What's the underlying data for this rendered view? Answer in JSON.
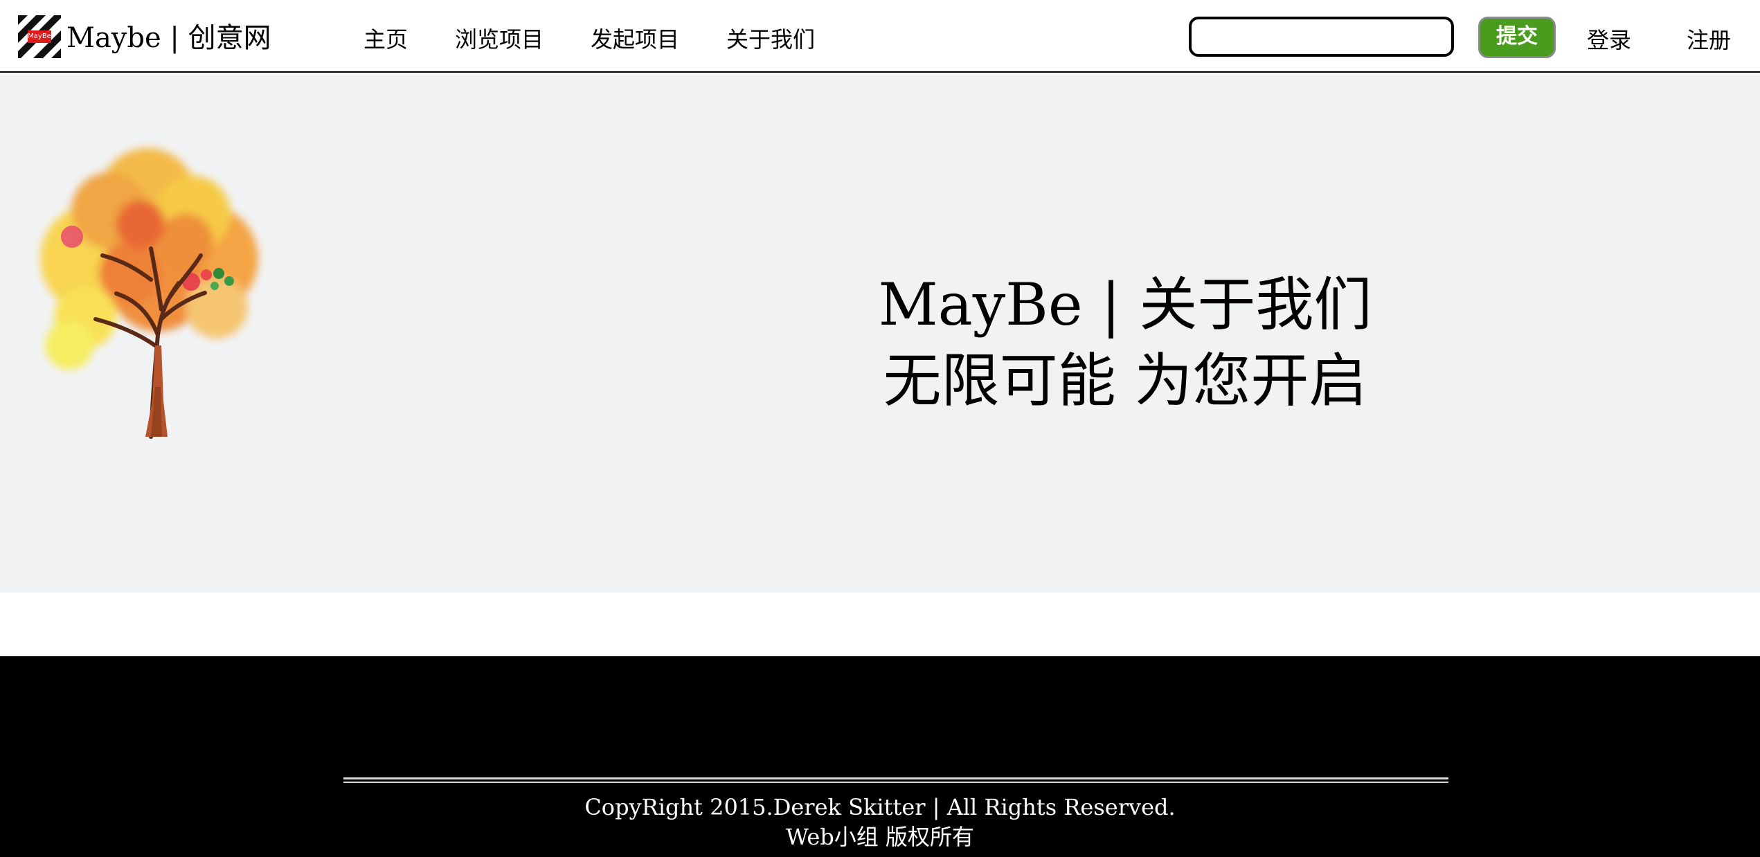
{
  "header": {
    "logo_text": "MayBe",
    "brand": "Maybe | 创意网",
    "nav": [
      {
        "label": "主页"
      },
      {
        "label": "浏览项目"
      },
      {
        "label": "发起项目"
      },
      {
        "label": "关于我们"
      }
    ],
    "search": {
      "value": "",
      "placeholder": ""
    },
    "submit_label": "提交",
    "login_label": "登录",
    "register_label": "注册"
  },
  "hero": {
    "title": "MayBe | 关于我们",
    "subtitle": "无限可能 为您开启"
  },
  "footer": {
    "copyright": "CopyRight 2015.Derek Skitter | All Rights Reserved.",
    "rights": "Web小组 版权所有"
  },
  "colors": {
    "hero_background": "#f1f2f4",
    "submit_button": "#4a9c1f",
    "footer_background": "#000000",
    "logo_red": "#e01b1b"
  }
}
